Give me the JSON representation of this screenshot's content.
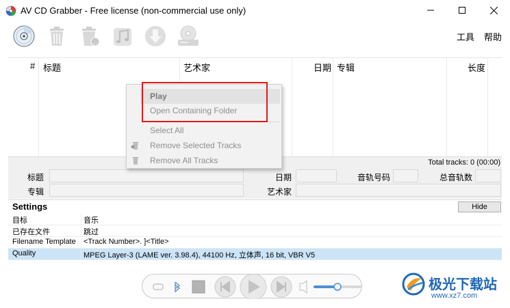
{
  "window": {
    "title": "AV CD Grabber - Free license (non-commercial use only)"
  },
  "toolbar": {
    "icons": [
      "cd-icon",
      "trash-icon",
      "trash-all-icon",
      "music-icon",
      "download-icon",
      "cd-drive-icon"
    ]
  },
  "menu": {
    "tools": "工具",
    "help": "帮助"
  },
  "tracklist": {
    "columns": {
      "number": "#",
      "title": "标题",
      "artist": "艺术家",
      "date": "日期",
      "album": "专辑",
      "length": "长度"
    },
    "total": "Total tracks: 0 (00:00)"
  },
  "details": {
    "title_label": "标题",
    "album_label": "专辑",
    "date_label": "日期",
    "artist_label": "艺术家",
    "track_number_label": "音轨号码",
    "total_tracks_label": "总音轨数"
  },
  "settings": {
    "title": "Settings",
    "hide_label": "Hide",
    "rows": [
      {
        "key": "目标",
        "value": "音乐"
      },
      {
        "key": "已存在文件",
        "value": "跳过"
      },
      {
        "key": "Filename Template",
        "value": "<Track Number>. ]<Title>"
      },
      {
        "key": "Quality",
        "value": "MPEG Layer-3 (LAME ver. 3.98.4), 44100 Hz, 立体声, 16 bit, VBR V5"
      }
    ]
  },
  "context_menu": {
    "play": "Play",
    "open_folder": "Open Containing Folder",
    "select_all": "Select All",
    "remove_selected": "Remove Selected Tracks",
    "remove_all": "Remove All Tracks"
  },
  "player": {
    "volume_level": 0.5
  },
  "watermark": {
    "name": "极光下载站",
    "url": "www.xz7.com"
  },
  "colors": {
    "selection": "#cce4f7",
    "highlight_box": "#e0191b",
    "watermark": "#1f67b8"
  }
}
